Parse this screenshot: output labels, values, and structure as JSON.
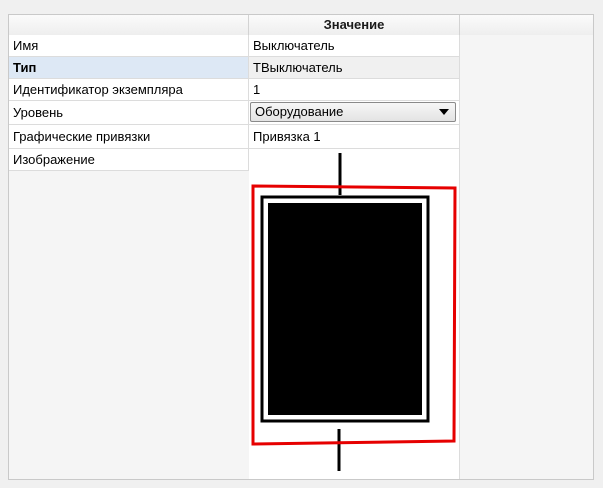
{
  "header": {
    "value_title": "Значение"
  },
  "rows": [
    {
      "label": "Имя",
      "value": "Выключатель"
    },
    {
      "label": "Тип",
      "value": "ТВыключатель"
    },
    {
      "label": "Идентификатор экземпляра",
      "value": "1"
    },
    {
      "label": "Уровень",
      "value": "Оборудование"
    },
    {
      "label": "Графические привязки",
      "value": "Привязка 1"
    },
    {
      "label": "Изображение",
      "value": ""
    }
  ],
  "image_preview": {
    "icon": "switch-symbol-icon",
    "colors": {
      "symbol": "#000000",
      "highlight": "#e60000"
    }
  }
}
